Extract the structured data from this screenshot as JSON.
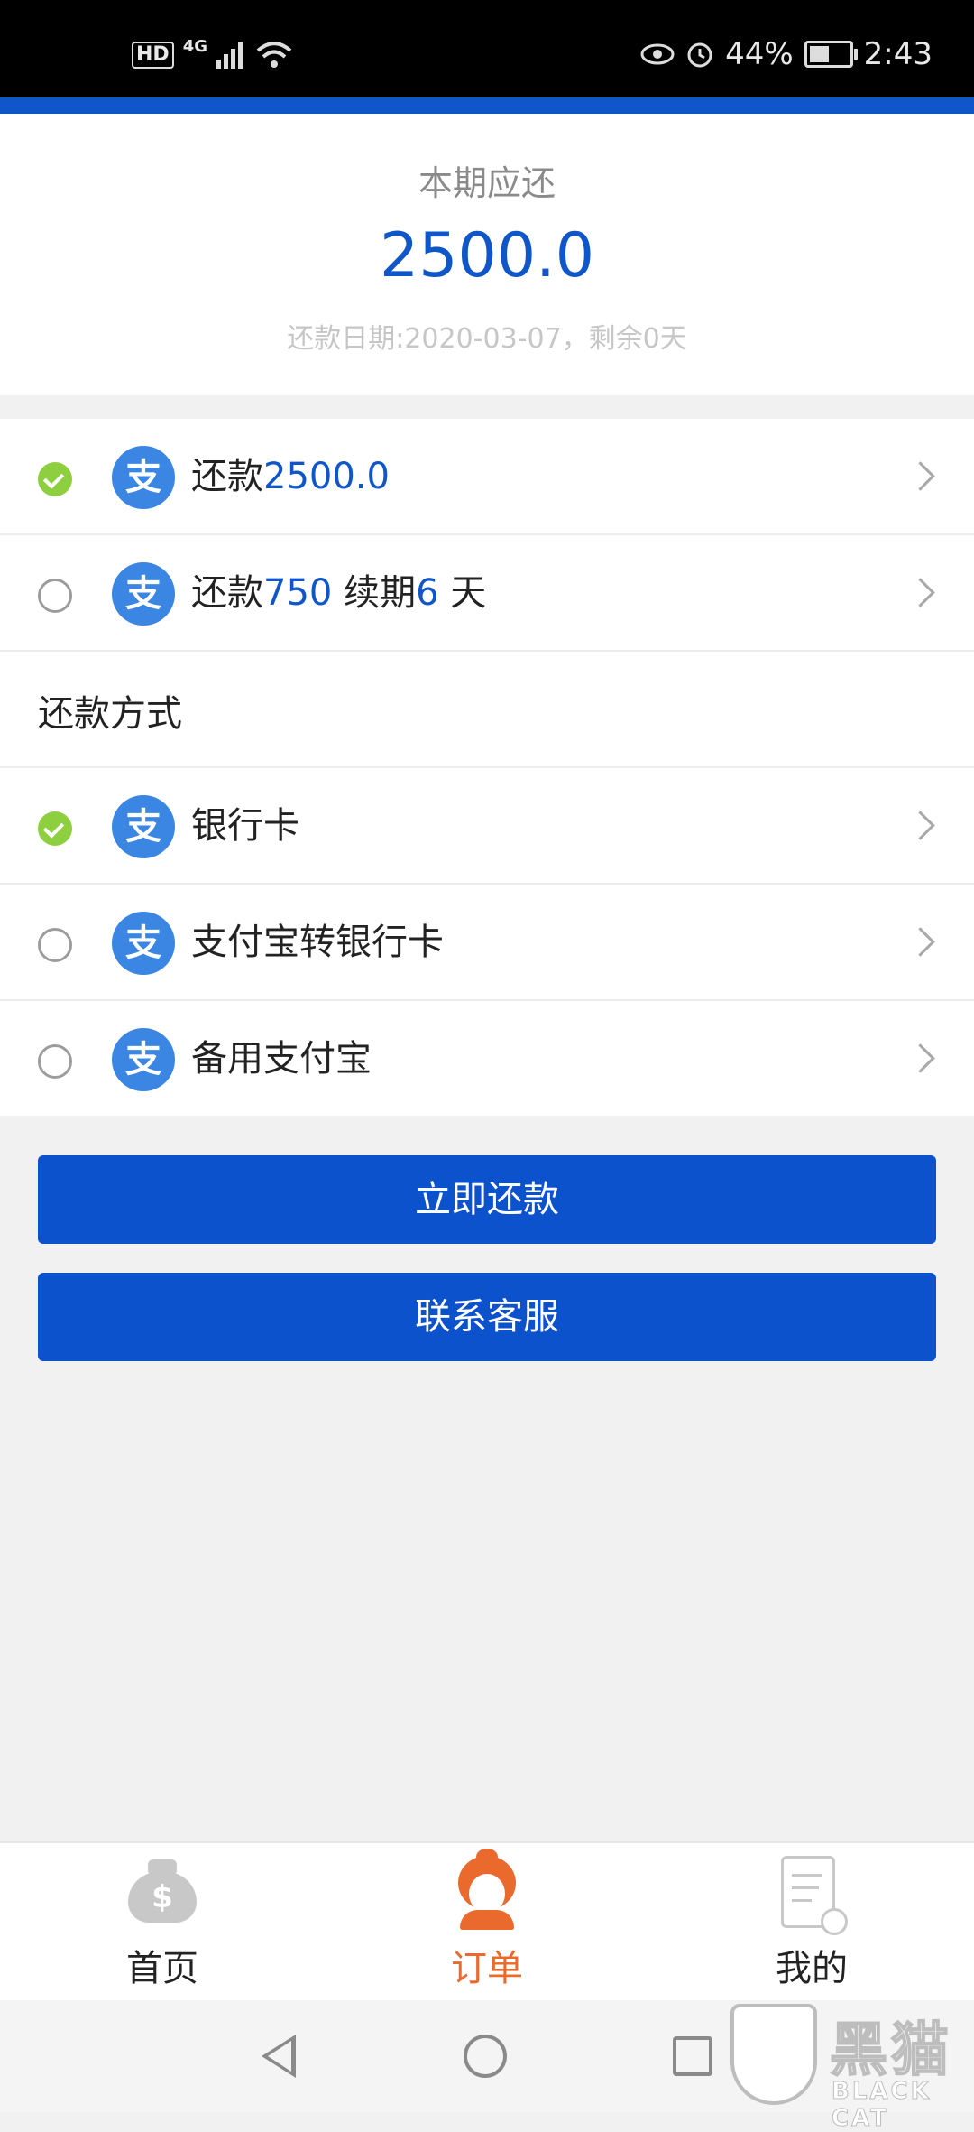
{
  "status_bar": {
    "hd": "HD",
    "network": "4G",
    "battery_percent": "44%",
    "time": "2:43"
  },
  "summary": {
    "label": "本期应还",
    "amount": "2500.0",
    "due_info": "还款日期:2020-03-07，剩余0天"
  },
  "options": [
    {
      "prefix": "还款",
      "amount": "2500.0",
      "checked": true,
      "icon": "alipay-icon"
    },
    {
      "prefix": "还款",
      "amount": "750",
      "middle": " 续期",
      "days": "6",
      "suffix": " 天",
      "checked": false,
      "icon": "alipay-icon"
    }
  ],
  "payment_section": {
    "title": "还款方式",
    "methods": [
      {
        "label": "银行卡",
        "checked": true,
        "icon": "alipay-icon"
      },
      {
        "label": "支付宝转银行卡",
        "checked": false,
        "icon": "alipay-icon"
      },
      {
        "label": "备用支付宝",
        "checked": false,
        "icon": "alipay-icon"
      }
    ]
  },
  "icon_glyph": "支",
  "actions": {
    "repay_now": "立即还款",
    "contact_service": "联系客服"
  },
  "tabbar": {
    "tabs": [
      {
        "label": "首页",
        "icon": "money-bag-icon",
        "active": false
      },
      {
        "label": "订单",
        "icon": "customer-service-icon",
        "active": true
      },
      {
        "label": "我的",
        "icon": "document-check-icon",
        "active": false
      }
    ],
    "money_glyph": "$"
  },
  "watermark": {
    "zh": "黑猫",
    "en": "BLACK CAT"
  },
  "colors": {
    "accent_blue": "#0f56c9",
    "check_green": "#8dcf3f",
    "active_tab_orange": "#ea6a2e"
  }
}
